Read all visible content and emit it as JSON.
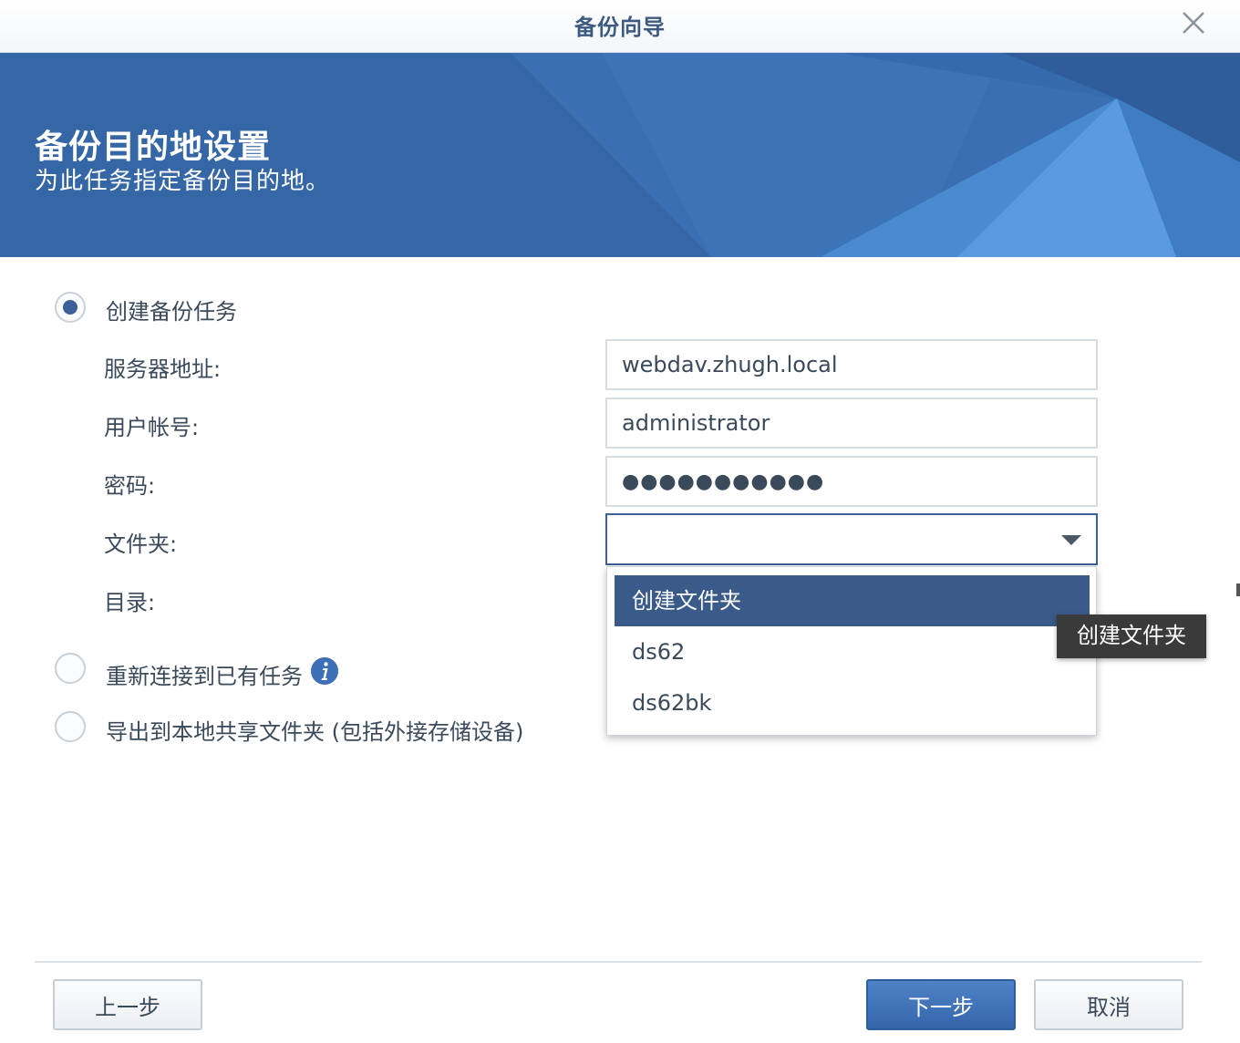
{
  "window": {
    "title": "备份向导",
    "close_icon": "close-icon"
  },
  "banner": {
    "heading": "备份目的地设置",
    "subheading": "为此任务指定备份目的地。"
  },
  "options": {
    "create_task": {
      "label": "创建备份任务",
      "checked": true
    },
    "reconnect_task": {
      "label": "重新连接到已有任务",
      "checked": false,
      "info_icon": "info-icon"
    },
    "export_local": {
      "label": "导出到本地共享文件夹 (包括外接存储设备)",
      "checked": false
    }
  },
  "form": {
    "server_label": "服务器地址:",
    "server_value": "webdav.zhugh.local",
    "user_label": "用户帐号:",
    "user_value": "administrator",
    "password_label": "密码:",
    "password_value": "●●●●●●●●●●●",
    "folder_label": "文件夹:",
    "folder_value": "",
    "directory_label": "目录:"
  },
  "dropdown": {
    "options": [
      "创建文件夹",
      "ds62",
      "ds62bk"
    ],
    "selected_index": 0
  },
  "tooltip": {
    "text": "创建文件夹"
  },
  "footer": {
    "back_label": "上一步",
    "next_label": "下一步",
    "cancel_label": "取消"
  },
  "colors": {
    "accent": "#3566a6",
    "title_text": "#3d5a80",
    "selected_option": "#3a5a8a",
    "primary_button": "#4277bd"
  }
}
